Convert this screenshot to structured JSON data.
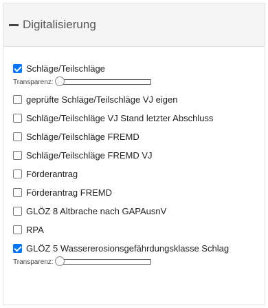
{
  "group": {
    "title": "Digitalisierung",
    "collapse_icon": "minus-icon"
  },
  "transparency_label": "Transparenz:",
  "layers": [
    {
      "label": "Schläge/Teilschläge",
      "checked": true,
      "transparency": 0
    },
    {
      "label": "geprüfte Schläge/Teilschläge VJ eigen",
      "checked": false
    },
    {
      "label": "Schläge/Teilschläge VJ Stand letzter Abschluss",
      "checked": false
    },
    {
      "label": "Schläge/Teilschläge FREMD",
      "checked": false
    },
    {
      "label": "Schläge/Teilschläge FREMD VJ",
      "checked": false
    },
    {
      "label": "Förderantrag",
      "checked": false
    },
    {
      "label": "Förderantrag FREMD",
      "checked": false
    },
    {
      "label": "GLÖZ 8 Altbrache nach GAPAusnV",
      "checked": false
    },
    {
      "label": "RPA",
      "checked": false
    },
    {
      "label": "GLÖZ 5 Wassererosionsgefährdungsklasse Schlag",
      "checked": true,
      "transparency": 0
    }
  ],
  "colors": {
    "checkbox_checked": "#0075ff",
    "header_bg": "#f5f5f5"
  }
}
